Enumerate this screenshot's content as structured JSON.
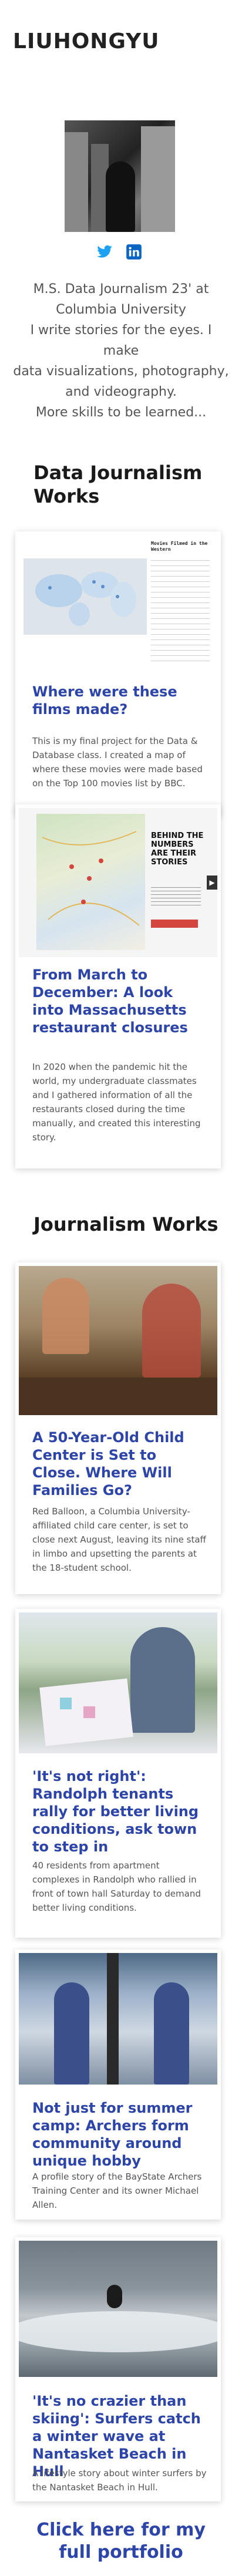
{
  "site": {
    "title": "LIUHONGYU"
  },
  "social": {
    "icons": [
      "twitter-icon",
      "linkedin-icon"
    ],
    "twitter_color": "#1da1f2",
    "linkedin_color": "#0a66c2"
  },
  "bio": {
    "lines": [
      "M.S. Data Journalism 23' at",
      "Columbia University",
      "I write stories for the eyes. I make",
      "data visualizations, photography,",
      "and videography.",
      "More skills to be learned..."
    ]
  },
  "sections": {
    "data_journalism": "Data Journalism Works",
    "journalism": "Journalism Works"
  },
  "data_cards": [
    {
      "title": "Where were these films made?",
      "description": "This is my final project for the Data & Database class. I created a map of where these movies were made based on the Top 100 movies list by BBC.",
      "thumb_heading": "Movies Filmed in the Western"
    },
    {
      "title": "From March to December: A look into Massachusetts restaurant closures",
      "description": "In 2020 when the pandemic hit the world, my undergraduate classmates and I gathered information of all the restaurants closed during the time manually, and created this interesting story.",
      "thumb_heading": "BEHIND THE NUMBERS ARE THEIR STORIES"
    }
  ],
  "journalism_cards": [
    {
      "title": "A 50-Year-Old Child Center is Set to Close. Where Will Families Go?",
      "description": "Red Balloon, a Columbia University-affiliated child care center, is set to close next August, leaving its nine staff in limbo and upsetting the parents at the 18-student school."
    },
    {
      "title": "'It's not right': Randolph tenants rally for better living conditions, ask town to step in",
      "description": "40 residents from apartment complexes in Randolph who rallied in front of town hall Saturday to demand better living conditions."
    },
    {
      "title": "Not just for summer camp: Archers form community around unique hobby",
      "description": "A profile story of the BayState Archers Training Center and its owner Michael Allen."
    },
    {
      "title": "'It's no crazier than skiing': Surfers catch a winter wave at Nantasket Beach in Hull",
      "description": "A lifestyle story about winter surfers by the Nantasket Beach in Hull."
    }
  ],
  "portfolio_link": "Click here for my full portfolio",
  "colors": {
    "link_blue": "#2d45a8",
    "heading": "#1a1a1a"
  }
}
